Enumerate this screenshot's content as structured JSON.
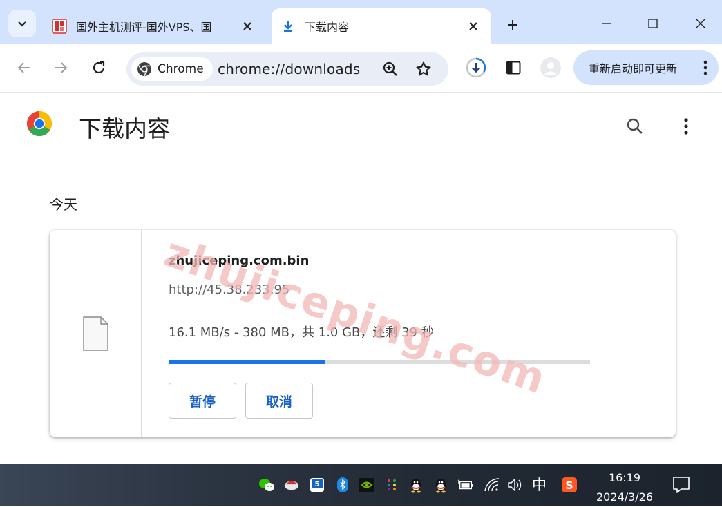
{
  "tabs": [
    {
      "title": "国外主机测评-国外VPS、国",
      "active": false
    },
    {
      "title": "下载内容",
      "active": true
    }
  ],
  "omnibox": {
    "chip_label": "Chrome",
    "url": "chrome://downloads"
  },
  "toolbar": {
    "update_label": "重新启动即可更新"
  },
  "page": {
    "title": "下载内容",
    "date_group": "今天"
  },
  "download": {
    "file_name": "zhujiceping.com.bin",
    "source_url": "http://45.38.233.95",
    "status": "16.1 MB/s - 380 MB，共 1.0 GB，还剩 39 秒",
    "progress_fraction": 0.37,
    "pause_label": "暂停",
    "cancel_label": "取消"
  },
  "watermark": "zhujiceping.com",
  "taskbar": {
    "ime": "中",
    "time": "16:19",
    "date": "2024/3/26"
  },
  "colors": {
    "tabstrip": "#d3e3fd",
    "accent": "#1a73e8",
    "button_text": "#1a62c8"
  }
}
